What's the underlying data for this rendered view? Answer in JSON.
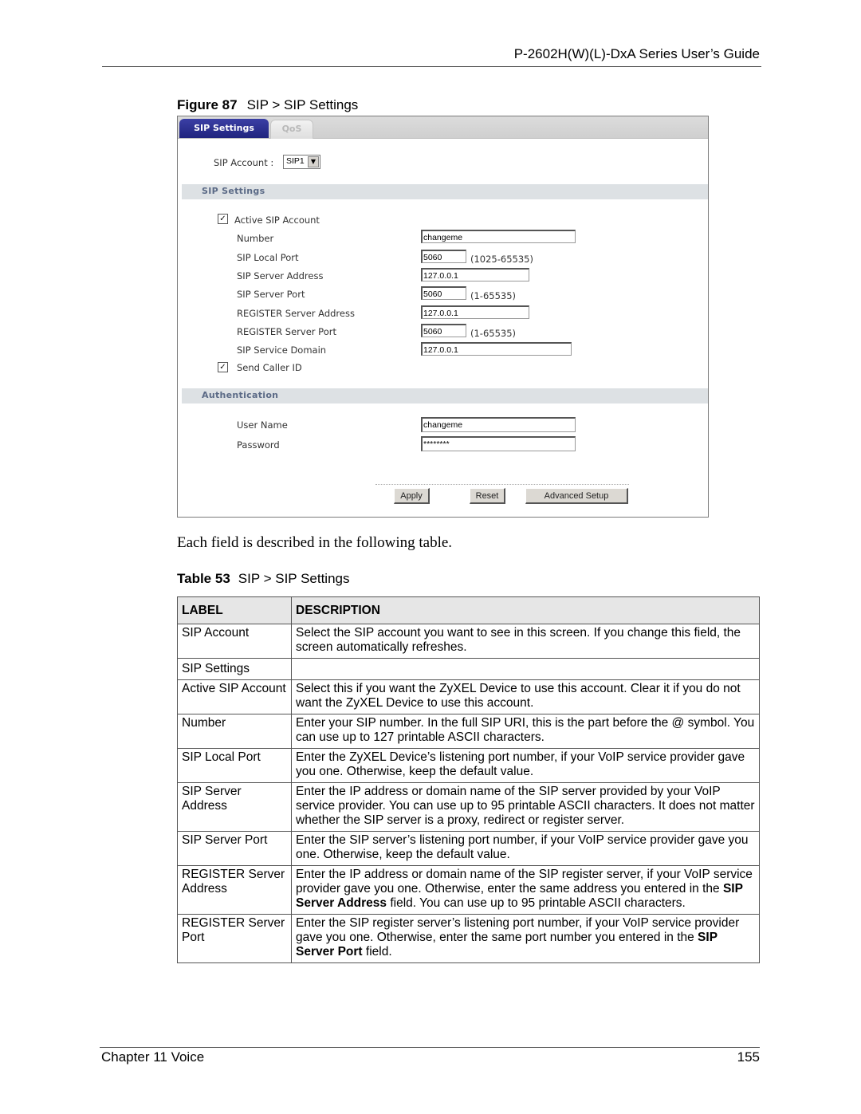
{
  "page_header": {
    "title": "P-2602H(W)(L)-DxA Series User’s Guide"
  },
  "figure": {
    "number": "Figure 87",
    "caption": "SIP > SIP Settings",
    "tabs": [
      {
        "label": "SIP Settings",
        "active": true
      },
      {
        "label": "QoS",
        "active": false
      }
    ],
    "sip_account": {
      "label": "SIP Account :",
      "selected": "SIP1"
    },
    "sip_settings_section": "SIP Settings",
    "active_sip_account": {
      "label": "Active SIP Account",
      "checked": true
    },
    "fields": {
      "number": {
        "label": "Number",
        "value": "changeme"
      },
      "sip_local_port": {
        "label": "SIP Local Port",
        "value": "5060",
        "range": "(1025-65535)"
      },
      "sip_server_address": {
        "label": "SIP Server Address",
        "value": "127.0.0.1"
      },
      "sip_server_port": {
        "label": "SIP Server Port",
        "value": "5060",
        "range": "(1-65535)"
      },
      "register_server_address": {
        "label": "REGISTER Server Address",
        "value": "127.0.0.1"
      },
      "register_server_port": {
        "label": "REGISTER Server Port",
        "value": "5060",
        "range": "(1-65535)"
      },
      "sip_service_domain": {
        "label": "SIP Service Domain",
        "value": "127.0.0.1"
      }
    },
    "send_caller_id": {
      "label": "Send Caller ID",
      "checked": true
    },
    "authentication_section": "Authentication",
    "auth": {
      "user_name": {
        "label": "User Name",
        "value": "changeme"
      },
      "password": {
        "label": "Password",
        "value": "********"
      }
    },
    "buttons": {
      "apply": "Apply",
      "reset": "Reset",
      "advanced": "Advanced Setup"
    }
  },
  "intro_text": "Each field is described in the following table.",
  "table": {
    "number": "Table 53",
    "caption": "SIP > SIP Settings",
    "headers": [
      "LABEL",
      "DESCRIPTION"
    ],
    "rows": [
      {
        "label": "SIP Account",
        "desc": "Select the SIP account you want to see in this screen. If you change this field, the screen automatically refreshes."
      },
      {
        "label": "SIP Settings",
        "desc": ""
      },
      {
        "label": "Active SIP Account",
        "desc": "Select this if you want the ZyXEL Device to use this account. Clear it if you do not want the ZyXEL Device to use this account."
      },
      {
        "label": "Number",
        "desc": "Enter your SIP number. In the full SIP URI, this is the part before the @ symbol. You can use up to 127 printable ASCII characters."
      },
      {
        "label": "SIP Local Port",
        "desc": "Enter the ZyXEL Device’s listening port number, if your VoIP service provider gave you one. Otherwise, keep the default value."
      },
      {
        "label": "SIP Server Address",
        "desc": "Enter the IP address or domain name of the SIP server provided by your VoIP service provider. You can use up to 95 printable ASCII characters. It does not matter whether the SIP server is a proxy, redirect or register server."
      },
      {
        "label": "SIP Server Port",
        "desc": "Enter the SIP server’s listening port number, if your VoIP service provider gave you one. Otherwise, keep the default value."
      },
      {
        "label": "REGISTER Server Address",
        "desc_pre": "Enter the IP address or domain name of the SIP register server, if your VoIP service provider gave you one. Otherwise, enter the same address you entered in the ",
        "desc_bold": "SIP Server Address",
        "desc_post": " field. You can use up to 95 printable ASCII characters."
      },
      {
        "label": "REGISTER Server Port",
        "desc_pre": "Enter the SIP register server’s listening port number, if your VoIP service provider gave you one. Otherwise, enter the same port number you entered in the ",
        "desc_bold": "SIP Server Port",
        "desc_post": " field."
      }
    ]
  },
  "page_footer": {
    "chapter": "Chapter 11 Voice",
    "page": "155"
  }
}
